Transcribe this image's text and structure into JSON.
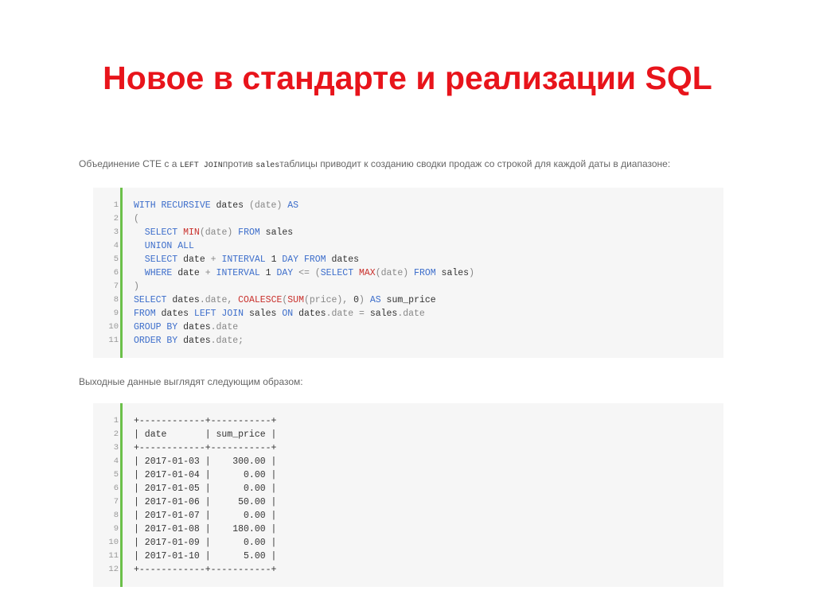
{
  "slide": {
    "title": "Новое в стандарте и реализации SQL"
  },
  "caption1": {
    "part1": "Объединение CTE с а ",
    "code1": "LEFT JOIN",
    "part2": "против ",
    "code2": "sales",
    "part3": "таблицы приводит к созданию сводки продаж со строкой для каждой даты в диапазоне:"
  },
  "caption2": {
    "text": "Выходные данные выглядят следующим образом:"
  },
  "colors": {
    "title": "#e8141b",
    "accent_bar": "#6cc04a",
    "keyword": "#3d6ecb",
    "function": "#c9302c",
    "code_background": "#f6f6f6"
  },
  "sql_code": {
    "lines": [
      {
        "number": "1",
        "tokens": [
          {
            "t": "WITH RECURSIVE",
            "c": "kw"
          },
          {
            "t": " dates ",
            "c": "pl"
          },
          {
            "t": "(date)",
            "c": "pn"
          },
          {
            "t": " AS",
            "c": "kw"
          }
        ]
      },
      {
        "number": "2",
        "tokens": [
          {
            "t": "(",
            "c": "pn"
          }
        ]
      },
      {
        "number": "3",
        "tokens": [
          {
            "t": "  SELECT ",
            "c": "kw"
          },
          {
            "t": "MIN",
            "c": "fn"
          },
          {
            "t": "(date)",
            "c": "pn"
          },
          {
            "t": " FROM",
            "c": "kw"
          },
          {
            "t": " sales",
            "c": "pl"
          }
        ]
      },
      {
        "number": "4",
        "tokens": [
          {
            "t": "  UNION ALL",
            "c": "kw"
          }
        ]
      },
      {
        "number": "5",
        "tokens": [
          {
            "t": "  SELECT",
            "c": "kw"
          },
          {
            "t": " date ",
            "c": "pl"
          },
          {
            "t": "+",
            "c": "pn"
          },
          {
            "t": " INTERVAL ",
            "c": "kw"
          },
          {
            "t": "1",
            "c": "num"
          },
          {
            "t": " DAY FROM",
            "c": "kw"
          },
          {
            "t": " dates",
            "c": "pl"
          }
        ]
      },
      {
        "number": "6",
        "tokens": [
          {
            "t": "  WHERE",
            "c": "kw"
          },
          {
            "t": " date ",
            "c": "pl"
          },
          {
            "t": "+",
            "c": "pn"
          },
          {
            "t": " INTERVAL ",
            "c": "kw"
          },
          {
            "t": "1",
            "c": "num"
          },
          {
            "t": " DAY ",
            "c": "kw"
          },
          {
            "t": "<= (",
            "c": "pn"
          },
          {
            "t": "SELECT ",
            "c": "kw"
          },
          {
            "t": "MAX",
            "c": "fn"
          },
          {
            "t": "(date)",
            "c": "pn"
          },
          {
            "t": " FROM",
            "c": "kw"
          },
          {
            "t": " sales",
            "c": "pl"
          },
          {
            "t": ")",
            "c": "pn"
          }
        ]
      },
      {
        "number": "7",
        "tokens": [
          {
            "t": ")",
            "c": "pn"
          }
        ]
      },
      {
        "number": "8",
        "tokens": [
          {
            "t": "SELECT",
            "c": "kw"
          },
          {
            "t": " dates",
            "c": "pl"
          },
          {
            "t": ".date, ",
            "c": "pn"
          },
          {
            "t": "COALESCE",
            "c": "fn"
          },
          {
            "t": "(",
            "c": "pn"
          },
          {
            "t": "SUM",
            "c": "fn"
          },
          {
            "t": "(price), ",
            "c": "pn"
          },
          {
            "t": "0",
            "c": "num"
          },
          {
            "t": ")",
            "c": "pn"
          },
          {
            "t": " AS",
            "c": "kw"
          },
          {
            "t": " sum_price",
            "c": "pl"
          }
        ]
      },
      {
        "number": "9",
        "tokens": [
          {
            "t": "FROM",
            "c": "kw"
          },
          {
            "t": " dates ",
            "c": "pl"
          },
          {
            "t": "LEFT JOIN",
            "c": "kw"
          },
          {
            "t": " sales ",
            "c": "pl"
          },
          {
            "t": "ON",
            "c": "kw"
          },
          {
            "t": " dates",
            "c": "pl"
          },
          {
            "t": ".date = ",
            "c": "pn"
          },
          {
            "t": "sales",
            "c": "pl"
          },
          {
            "t": ".date",
            "c": "pn"
          }
        ]
      },
      {
        "number": "10",
        "tokens": [
          {
            "t": "GROUP BY",
            "c": "kw"
          },
          {
            "t": " dates",
            "c": "pl"
          },
          {
            "t": ".date",
            "c": "pn"
          }
        ]
      },
      {
        "number": "11",
        "tokens": [
          {
            "t": "ORDER BY",
            "c": "kw"
          },
          {
            "t": " dates",
            "c": "pl"
          },
          {
            "t": ".date;",
            "c": "pn"
          }
        ]
      }
    ]
  },
  "output_code": {
    "lines": [
      {
        "number": "1",
        "text": "+------------+-----------+"
      },
      {
        "number": "2",
        "text": "| date       | sum_price |"
      },
      {
        "number": "3",
        "text": "+------------+-----------+"
      },
      {
        "number": "4",
        "text": "| 2017-01-03 |    300.00 |"
      },
      {
        "number": "5",
        "text": "| 2017-01-04 |      0.00 |"
      },
      {
        "number": "6",
        "text": "| 2017-01-05 |      0.00 |"
      },
      {
        "number": "7",
        "text": "| 2017-01-06 |     50.00 |"
      },
      {
        "number": "8",
        "text": "| 2017-01-07 |      0.00 |"
      },
      {
        "number": "9",
        "text": "| 2017-01-08 |    180.00 |"
      },
      {
        "number": "10",
        "text": "| 2017-01-09 |      0.00 |"
      },
      {
        "number": "11",
        "text": "| 2017-01-10 |      5.00 |"
      },
      {
        "number": "12",
        "text": "+------------+-----------+"
      }
    ]
  }
}
